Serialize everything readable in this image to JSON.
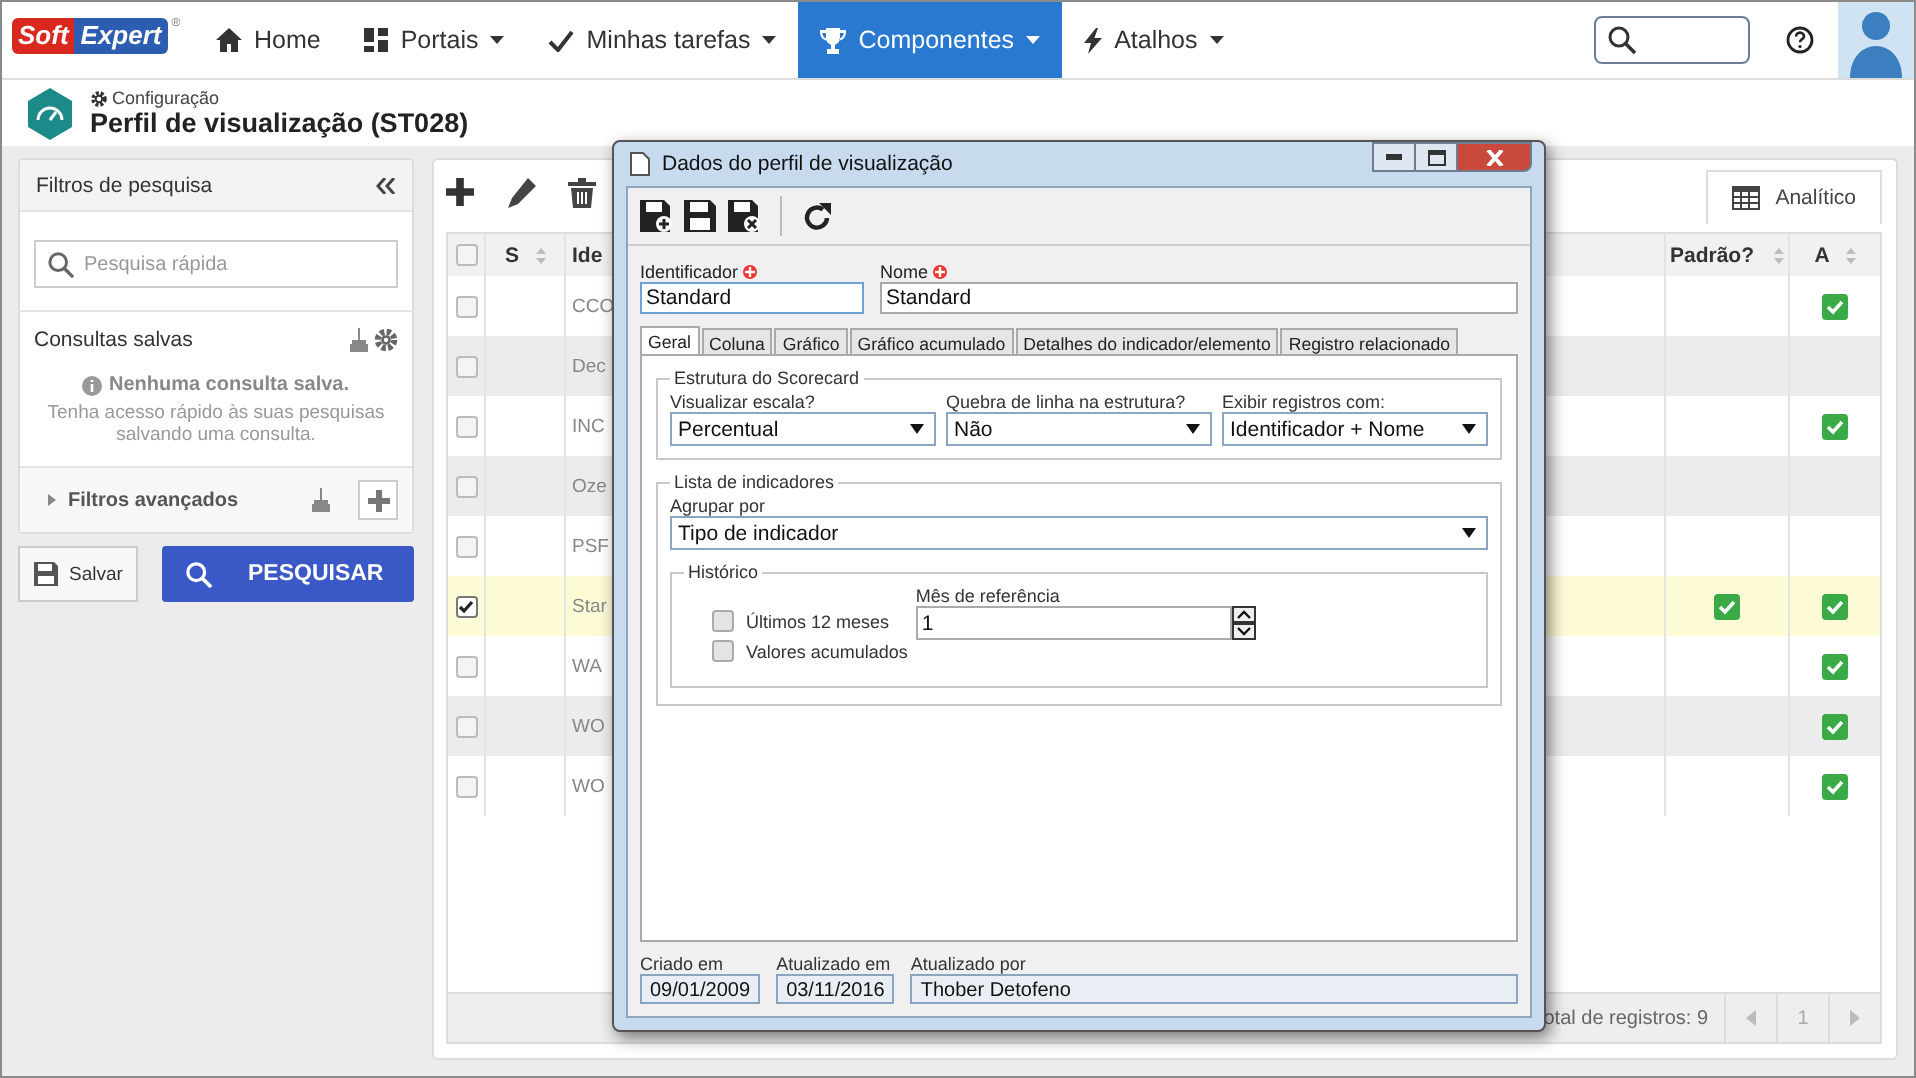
{
  "logo": {
    "parts": [
      "Soft",
      "Expert"
    ],
    "mark": "®"
  },
  "nav": [
    {
      "label": "Home",
      "kind": "home",
      "dropdown": false,
      "selected": false
    },
    {
      "label": "Portais",
      "kind": "portals",
      "dropdown": true,
      "selected": false
    },
    {
      "label": "Minhas tarefas",
      "kind": "tasks",
      "dropdown": true,
      "selected": false
    },
    {
      "label": "Componentes",
      "kind": "components",
      "dropdown": true,
      "selected": true
    },
    {
      "label": "Atalhos",
      "kind": "shortcuts",
      "dropdown": true,
      "selected": false
    }
  ],
  "header": {
    "breadcrumb": "Configuração",
    "title": "Perfil de visualização (ST028)"
  },
  "filters": {
    "title": "Filtros de pesquisa",
    "search_placeholder": "Pesquisa rápida",
    "saved_title": "Consultas salvas",
    "empty_title": "Nenhuma consulta salva.",
    "empty_hint": "Tenha acesso rápido às suas pesquisas salvando uma consulta.",
    "advanced": "Filtros avançados",
    "save_button": "Salvar",
    "search_button": "PESQUISAR"
  },
  "grid": {
    "view_tab": "Analítico",
    "all_checked": false,
    "columns": [
      "S",
      "Ide",
      "Padrão?",
      "A"
    ],
    "rows": [
      {
        "ident": "CCO",
        "selected": false,
        "checked": false,
        "default": false,
        "active": true
      },
      {
        "ident": "Dec",
        "selected": false,
        "checked": false,
        "default": false,
        "active": false
      },
      {
        "ident": "INC",
        "selected": false,
        "checked": false,
        "default": false,
        "active": true
      },
      {
        "ident": "Oze",
        "selected": false,
        "checked": false,
        "default": false,
        "active": false
      },
      {
        "ident": "PSF",
        "selected": false,
        "checked": false,
        "default": false,
        "active": false
      },
      {
        "ident": "Star",
        "selected": true,
        "checked": true,
        "default": true,
        "active": true
      },
      {
        "ident": "WA",
        "selected": false,
        "checked": false,
        "default": false,
        "active": true
      },
      {
        "ident": "WO",
        "selected": false,
        "checked": false,
        "default": false,
        "active": true
      },
      {
        "ident": "WO",
        "selected": false,
        "checked": false,
        "default": false,
        "active": true
      }
    ],
    "total": "otal de registros: 9",
    "page": "1"
  },
  "dialog": {
    "title": "Dados do perfil de visualização",
    "identifier": {
      "label": "Identificador",
      "value": "Standard",
      "required": true
    },
    "name": {
      "label": "Nome",
      "value": "Standard",
      "required": true
    },
    "tabs": [
      {
        "label": "Geral",
        "selected": true
      },
      {
        "label": "Coluna",
        "selected": false
      },
      {
        "label": "Gráfico",
        "selected": false
      },
      {
        "label": "Gráfico acumulado",
        "selected": false
      },
      {
        "label": "Detalhes do indicador/elemento",
        "selected": false
      },
      {
        "label": "Registro relacionado",
        "selected": false
      }
    ],
    "scorecard": {
      "legend": "Estrutura do Scorecard",
      "selects": [
        {
          "label": "Visualizar escala?",
          "value": "Percentual"
        },
        {
          "label": "Quebra de linha na estrutura?",
          "value": "Não"
        },
        {
          "label": "Exibir registros com:",
          "value": "Identificador + Nome"
        }
      ]
    },
    "indicators": {
      "legend": "Lista de indicadores",
      "group_label": "Agrupar por",
      "group_value": "Tipo de indicador",
      "history": {
        "legend": "Histórico",
        "options": [
          {
            "label": "Últimos 12 meses",
            "checked": false
          },
          {
            "label": "Valores acumulados",
            "checked": false
          }
        ],
        "month_label": "Mês de referência",
        "month_value": "1"
      }
    },
    "footer": [
      {
        "label": "Criado em",
        "value": "09/01/2009"
      },
      {
        "label": "Atualizado em",
        "value": "03/11/2016"
      },
      {
        "label": "Atualizado por",
        "value": "Thober Detofeno"
      }
    ]
  }
}
